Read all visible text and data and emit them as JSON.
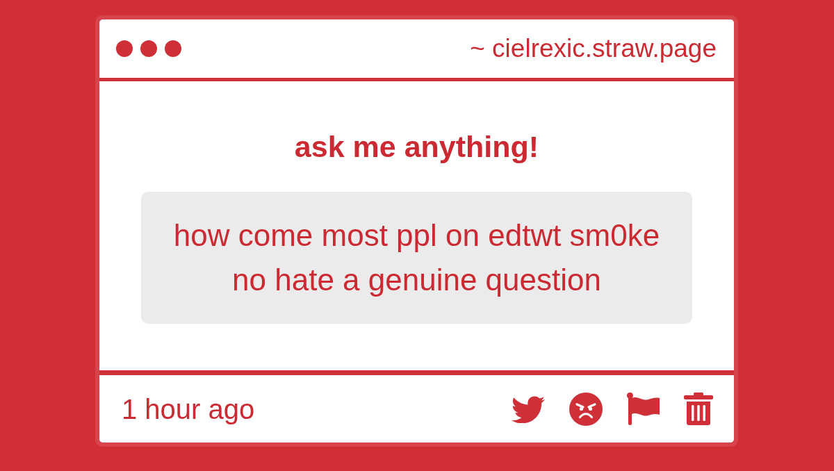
{
  "window": {
    "address": "~ cielrexic.straw.page"
  },
  "prompt": {
    "title": "ask me anything!"
  },
  "question": {
    "text": "how come most ppl on edtwt sm0ke no hate a genuine question"
  },
  "footer": {
    "time": "1 hour ago",
    "actions": [
      {
        "kind": "share"
      },
      {
        "kind": "react"
      },
      {
        "kind": "report"
      },
      {
        "kind": "delete"
      }
    ]
  }
}
